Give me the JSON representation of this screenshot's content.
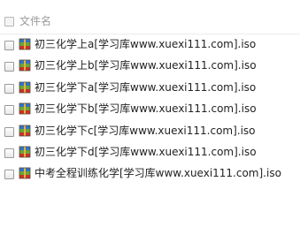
{
  "header": {
    "column_label": "文件名"
  },
  "files": [
    {
      "name": "初三化学上a[学习库www.xuexi111.com].iso",
      "icon": "iso-archive-icon"
    },
    {
      "name": "初三化学上b[学习库www.xuexi111.com].iso",
      "icon": "iso-archive-icon"
    },
    {
      "name": "初三化学下a[学习库www.xuexi111.com].iso",
      "icon": "iso-archive-icon"
    },
    {
      "name": "初三化学下b[学习库www.xuexi111.com].iso",
      "icon": "iso-archive-icon"
    },
    {
      "name": "初三化学下c[学习库www.xuexi111.com].iso",
      "icon": "iso-archive-icon"
    },
    {
      "name": "初三化学下d[学习库www.xuexi111.com].iso",
      "icon": "iso-archive-icon"
    },
    {
      "name": "中考全程训练化学[学习库www.xuexi111.com].iso",
      "icon": "iso-archive-icon"
    }
  ],
  "colors": {
    "icon_top": "#2f74c8",
    "icon_middle": "#6aa636",
    "icon_bottom": "#c9302c",
    "icon_band": "#e8b23a"
  }
}
